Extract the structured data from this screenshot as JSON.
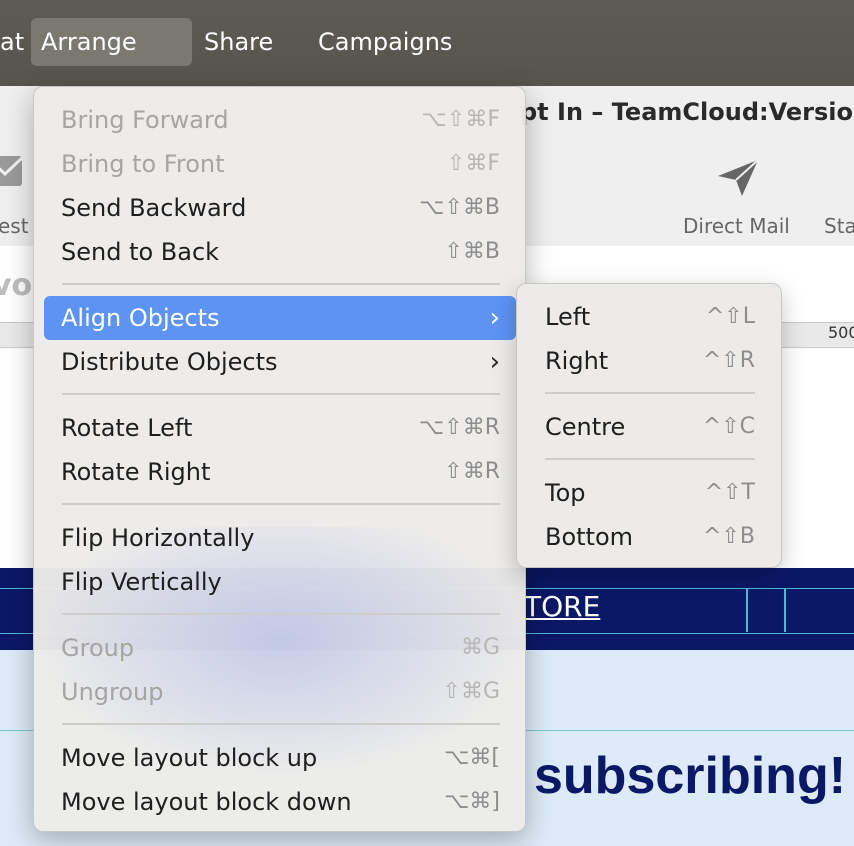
{
  "menubar": {
    "items": [
      {
        "label": "at"
      },
      {
        "label": "Arrange",
        "active": true
      },
      {
        "label": "Share"
      },
      {
        "label": "Campaigns"
      }
    ]
  },
  "window": {
    "title": "pt In – TeamCloud:Version",
    "toolbar": {
      "left_label": "est",
      "direct_mail_label": "Direct Mail",
      "right_label": "Sta"
    },
    "ruler_label": "500",
    "canvas_snippet": "vo",
    "nav_link": "TORE",
    "headline": "subscribing!"
  },
  "menu": {
    "items": [
      {
        "label": "Bring Forward",
        "shortcut": "⌥⇧⌘F",
        "enabled": false
      },
      {
        "label": "Bring to Front",
        "shortcut": "⇧⌘F",
        "enabled": false
      },
      {
        "label": "Send Backward",
        "shortcut": "⌥⇧⌘B",
        "enabled": true
      },
      {
        "label": "Send to Back",
        "shortcut": "⇧⌘B",
        "enabled": true
      },
      {
        "label": "Align Objects",
        "submenu": true,
        "highlighted": true
      },
      {
        "label": "Distribute Objects",
        "submenu": true
      },
      {
        "label": "Rotate Left",
        "shortcut": "⌥⇧⌘R",
        "enabled": true
      },
      {
        "label": "Rotate Right",
        "shortcut": "⇧⌘R",
        "enabled": true
      },
      {
        "label": "Flip Horizontally",
        "enabled": true
      },
      {
        "label": "Flip Vertically",
        "enabled": true
      },
      {
        "label": "Group",
        "shortcut": "⌘G",
        "enabled": false
      },
      {
        "label": "Ungroup",
        "shortcut": "⇧⌘G",
        "enabled": false
      },
      {
        "label": "Move layout block up",
        "shortcut": "⌥⌘[",
        "enabled": true
      },
      {
        "label": "Move layout block down",
        "shortcut": "⌥⌘]",
        "enabled": true
      }
    ],
    "chevron": "›"
  },
  "submenu": {
    "items": [
      {
        "label": "Left",
        "shortcut": "^⇧L"
      },
      {
        "label": "Right",
        "shortcut": "^⇧R"
      },
      {
        "label": "Centre",
        "shortcut": "^⇧C"
      },
      {
        "label": "Top",
        "shortcut": "^⇧T"
      },
      {
        "label": "Bottom",
        "shortcut": "^⇧B"
      }
    ]
  },
  "colors": {
    "highlight": "#5d93f3",
    "navbar": "#0b1866",
    "headline": "#0b1866"
  }
}
